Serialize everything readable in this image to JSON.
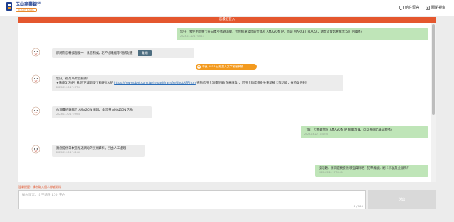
{
  "header": {
    "brand": "玉山商業銀行",
    "brand_sub": "E.SUN BANK",
    "nav": [
      {
        "label": "給在留言",
        "icon": "message-icon"
      },
      {
        "label": "關閉視窗",
        "icon": "close-icon"
      }
    ]
  },
  "chat": {
    "banner": "您最近登入",
    "messages": [
      {
        "text": "您好，我使用新帳卡在日本亞馬遜消費，但我帳單發現的金額為 AMAZON JP，而是 MARKET PLAZA，請問這會影響我享 5% 回饋嗎?",
        "time": "2023-03-20 17:04:13"
      },
      {
        "text": "即將為您轉接客服中，請您稍候，若不想繼續等待請點選",
        "button": "離開"
      },
      {
        "join": "專員 2816 已經加入文字客服系統"
      },
      {
        "text1": "您好，很高興為您服務！",
        "text2": "★快捷又方便！歡迎下載新版行動銀行APP",
        "link": "https://www.ubot.com.tw/reload/transferUbotAPP.htm",
        "text3": "查詢信用卡消費明細(含未請款)，可用卡額度或掛失重新補卡等功能，省時又便利！",
        "time": "2023-03-20 17:27:55"
      },
      {
        "text": "依消費紀錄顯示 AMAZON 來源，會影響 AMAZON 活動",
        "time": "2023-03-20 17:29:56"
      },
      {
        "text": "了解，但我確實在 AMAZON JP 網購消費，可以查詢此筆交易嗎?",
        "time": "2023-03-20 17:30:00"
      },
      {
        "text": "請您提供日本亞馬遜網站的交易資料，另由人工處理",
        "time": "2023-03-20 17:31:40"
      },
      {
        "text": "沒問題，請問是要提供哪些資料呢？訂單編號，刷卡卡號及金額嗎？",
        "time": "2023-03-20 17:33:51"
      }
    ]
  },
  "composer": {
    "hint": "溫馨提醒：請勿輸入個人機敏資料",
    "placeholder": "輸入留言，文字請限 150 字內",
    "counter": "0 / 150",
    "send_label": "送出"
  }
}
